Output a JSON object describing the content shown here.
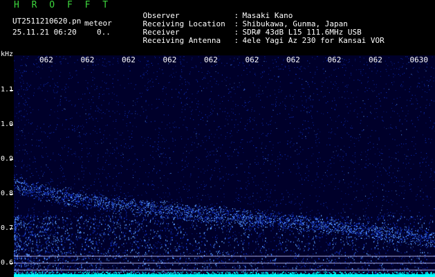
{
  "header": {
    "app_title": "H R O F F T",
    "file_name": "UT2511210620.pn",
    "file_type": "meteor",
    "timestamp": "25.11.21 06:20",
    "status": "0.."
  },
  "info": [
    {
      "label": "Observer",
      "value": "Masaki Kano"
    },
    {
      "label": "Receiving Location",
      "value": "Shibukawa, Gunma, Japan"
    },
    {
      "label": "Receiver",
      "value": "SDR# 43dB L15 111.6MHz USB"
    },
    {
      "label": "Receiving Antenna",
      "value": "4ele Yagi Az 230 for Kansai VOR"
    }
  ],
  "spectrogram": {
    "unit": "kHz",
    "freq_ticks": [
      "1.1",
      "1.0",
      "0.9",
      "0.8",
      "0.7",
      "0.6"
    ],
    "freq_values": [
      1.1,
      1.0,
      0.9,
      0.8,
      0.7,
      0.6
    ],
    "time_ticks": [
      "062",
      "062",
      "062",
      "062",
      "062",
      "062",
      "062",
      "062",
      "062",
      "0630"
    ],
    "reference_lines_khz": [
      0.62,
      0.6,
      0.58
    ],
    "colors": {
      "background": "#00002a",
      "noise": "#1030c0",
      "signal": "#5a9cff",
      "baseline": "#00ffff",
      "reference_line": "#c8c8ff"
    }
  }
}
